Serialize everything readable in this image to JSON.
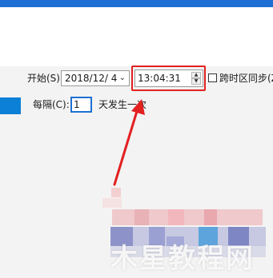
{
  "schedule": {
    "start_label": "开始(S):",
    "date_value": "2018/12/  4",
    "time_value": "13:04:31",
    "sync_timezone_label": "跨时区同步(Z)",
    "repeat_label": "每隔(C):",
    "repeat_value": "1",
    "repeat_unit_text": "天发生一次"
  },
  "watermark": {
    "text": "木星教程网"
  },
  "colors": {
    "accent": "#1e6fd3",
    "highlight": "#e32020"
  }
}
